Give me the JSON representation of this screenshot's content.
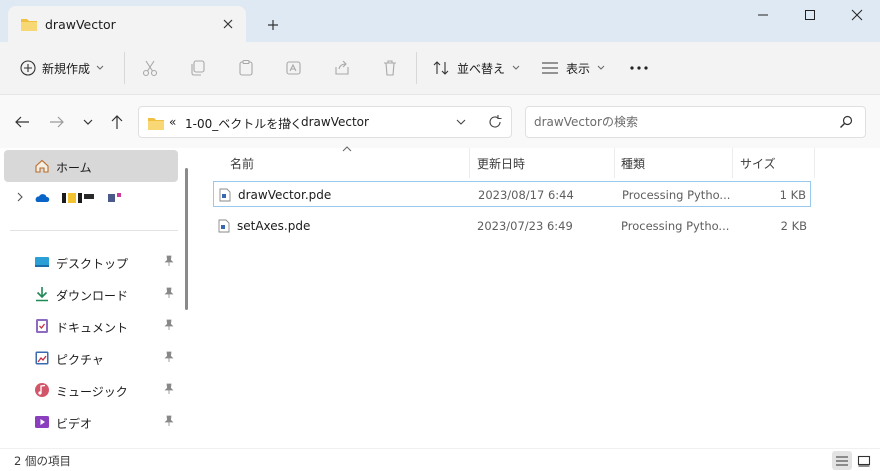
{
  "tab": {
    "title": "drawVector"
  },
  "toolbar": {
    "new_label": "新規作成",
    "sort_label": "並べ替え",
    "view_label": "表示"
  },
  "address": {
    "overflow": "«",
    "crumbs": [
      "1-00_ベクトルを描く",
      "drawVector"
    ],
    "separator": "›"
  },
  "search": {
    "placeholder": "drawVectorの検索"
  },
  "sidebar": {
    "home_label": "ホーム",
    "items": [
      {
        "label": "デスクトップ",
        "icon": "desktop-icon"
      },
      {
        "label": "ダウンロード",
        "icon": "download-icon"
      },
      {
        "label": "ドキュメント",
        "icon": "documents-icon"
      },
      {
        "label": "ピクチャ",
        "icon": "pictures-icon"
      },
      {
        "label": "ミュージック",
        "icon": "music-icon"
      },
      {
        "label": "ビデオ",
        "icon": "videos-icon"
      }
    ]
  },
  "columns": {
    "name": "名前",
    "date": "更新日時",
    "type": "種類",
    "size": "サイズ"
  },
  "files": [
    {
      "name": "drawVector.pde",
      "date": "2023/08/17 6:44",
      "type": "Processing Pytho...",
      "size": "1 KB",
      "selected": true
    },
    {
      "name": "setAxes.pde",
      "date": "2023/07/23 6:49",
      "type": "Processing Pytho...",
      "size": "2 KB",
      "selected": false
    }
  ],
  "status": {
    "item_count": "2 個の項目"
  },
  "colors": {
    "accent": "#0067c0",
    "folder": "#f0c040",
    "selection_border": "#99c9ef",
    "titlebar": "#dfe9f3"
  }
}
